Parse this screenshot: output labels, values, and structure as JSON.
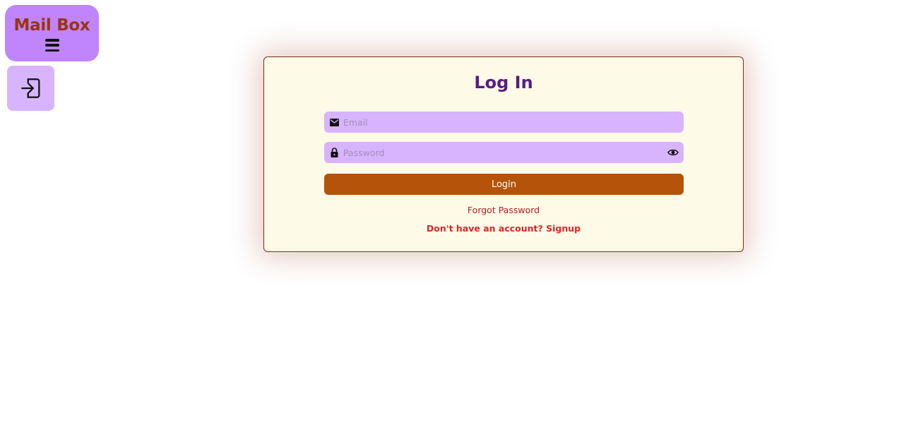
{
  "brand": {
    "title": "Mail Box",
    "menu_icon": "hamburger-menu-icon"
  },
  "sidebar": {
    "login_icon": "login-enter-icon"
  },
  "login_form": {
    "title": "Log In",
    "email": {
      "icon": "envelope-icon",
      "placeholder": "Email",
      "value": ""
    },
    "password": {
      "icon": "lock-icon",
      "placeholder": "Password",
      "value": "",
      "toggle_icon": "eye-icon"
    },
    "submit_label": "Login",
    "forgot_password_label": "Forgot Password",
    "signup_label": "Don't have an account? Signup"
  },
  "colors": {
    "brand_bg": "#c084fc",
    "brand_text": "#9a3412",
    "field_bg": "#d8b4fe",
    "card_bg": "#fefae8",
    "card_border": "#7c2d12",
    "title": "#581c87",
    "button_bg": "#b45309",
    "link": "#b91c1c"
  }
}
